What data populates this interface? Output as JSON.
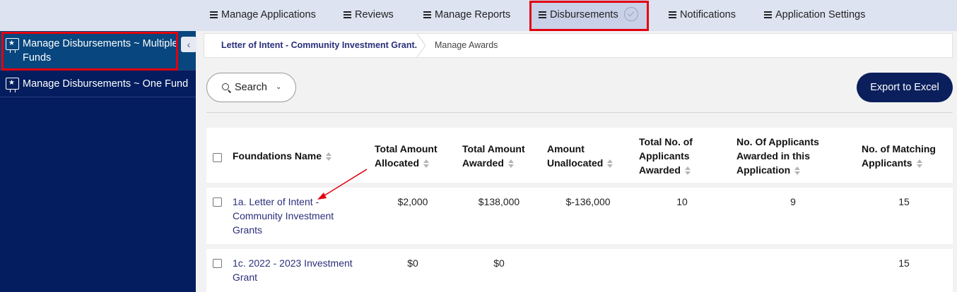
{
  "topnav": {
    "items": [
      {
        "label": "Manage Applications"
      },
      {
        "label": "Reviews"
      },
      {
        "label": "Manage Reports"
      },
      {
        "label": "Disbursements"
      },
      {
        "label": "Notifications"
      },
      {
        "label": "Application Settings"
      }
    ],
    "active": "Disbursements"
  },
  "sidebar": {
    "items": [
      {
        "label_line1": "Manage Disbursements ~ Multiple",
        "label_line2": "Funds",
        "icon": "award-certificate-icon"
      },
      {
        "label": "Manage Disbursements ~ One Fund",
        "icon": "award-certificate-icon"
      }
    ]
  },
  "breadcrumb": {
    "parent": "Letter of Intent - Community Investment Grant.",
    "current": "Manage Awards"
  },
  "toolbar": {
    "search_label": "Search",
    "export_label": "Export to Excel"
  },
  "table": {
    "headers": {
      "name": "Foundations Name",
      "allocated_1": "Total Amount",
      "allocated_2": "Allocated",
      "awarded_1": "Total Amount",
      "awarded_2": "Awarded",
      "unallocated_1": "Amount",
      "unallocated_2": "Unallocated",
      "applicants_1": "Total No. of",
      "applicants_2": "Applicants",
      "applicants_3": "Awarded",
      "inapp_1": "No. Of Applicants",
      "inapp_2": "Awarded in this",
      "inapp_3": "Application",
      "matching_1": "No. of Matching",
      "matching_2": "Applicants"
    },
    "rows": [
      {
        "name_1": "1a. Letter of Intent -",
        "name_2": "Community Investment",
        "name_3": "Grants",
        "allocated": "$2,000",
        "awarded": "$138,000",
        "unallocated": "$-136,000",
        "applicants_awarded": "10",
        "awarded_in_app": "9",
        "matching": "15"
      },
      {
        "name_1": "1c. 2022 - 2023 Investment",
        "name_2": "Grant",
        "allocated": "$0",
        "awarded": "$0",
        "unallocated": "",
        "applicants_awarded": "",
        "awarded_in_app": "",
        "matching": "15"
      }
    ]
  },
  "colors": {
    "sidebar_bg": "#031d5e",
    "sidebar_active": "#07467e",
    "export_bg": "#0a1f5c",
    "link": "#2a2f7a",
    "highlight": "#e3000f"
  }
}
